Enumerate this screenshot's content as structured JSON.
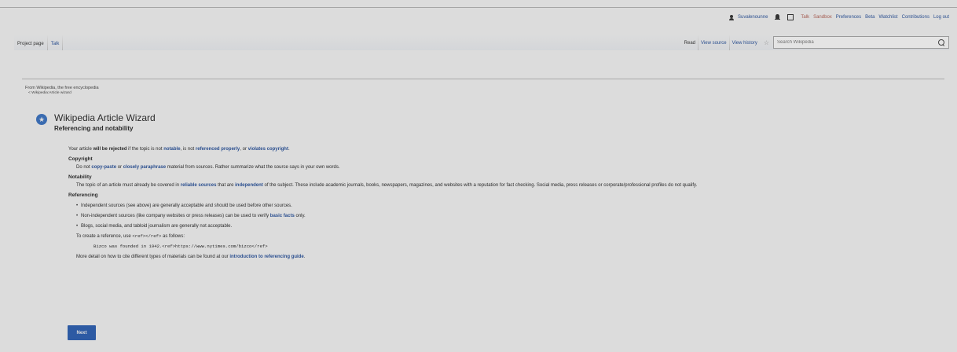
{
  "personal": {
    "username": "Suvalenounne",
    "talk": "Talk",
    "sandbox": "Sandbox",
    "preferences": "Preferences",
    "beta": "Beta",
    "watchlist": "Watchlist",
    "contributions": "Contributions",
    "logout": "Log out"
  },
  "tabs": {
    "project_page": "Project page",
    "talk": "Talk",
    "read": "Read",
    "view_source": "View source",
    "view_history": "View history"
  },
  "search": {
    "placeholder": "Search Wikipedia"
  },
  "page": {
    "site_sub": "From Wikipedia, the free encyclopedia",
    "breadcrumb": "< Wikipedia:Article wizard",
    "title": "Wikipedia Article Wizard",
    "subtitle": "Referencing and notability"
  },
  "intro": {
    "t1": "Your article ",
    "b1": "will be rejected",
    "t2": " if the topic is not ",
    "l1": "notable",
    "t3": ", is not ",
    "l2": "referenced properly",
    "t4": ", or ",
    "l3": "violates copyright",
    "t5": "."
  },
  "copyright": {
    "heading": "Copyright",
    "t1": "Do not ",
    "l1": "copy-paste",
    "t2": " or ",
    "l2": "closely paraphrase",
    "t3": " material from sources. Rather summarize what the source says in your own words."
  },
  "notability": {
    "heading": "Notability",
    "t1": "The topic of an article must already be covered in ",
    "l1": "reliable sources",
    "t2": " that are ",
    "l2": "independent",
    "t3": " of the subject. These include academic journals, books, newspapers, magazines, and websites with a reputation for fact checking. Social media, press releases or corporate/professional profiles do not qualify."
  },
  "referencing": {
    "heading": "Referencing",
    "b1": "Independent sources (see above) are generally acceptable and should be used before other sources.",
    "b2_t": "Non-independent sources (like company websites or press releases) can be used to verify ",
    "b2_l": "basic facts",
    "b2_e": " only.",
    "b3": "Blogs, social media, and tabloid journalism are generally not acceptable.",
    "create_t": "To create a reference, use ",
    "create_code": "<ref></ref>",
    "create_e": " as follows:",
    "example": "Bizco was founded in 1942.<ref>https://www.nytimes.com/bizco</ref>",
    "more_t": "More detail on how to cite different types of materials can be found at our ",
    "more_l": "introduction to referencing guide",
    "more_e": "."
  },
  "next_label": "Next"
}
